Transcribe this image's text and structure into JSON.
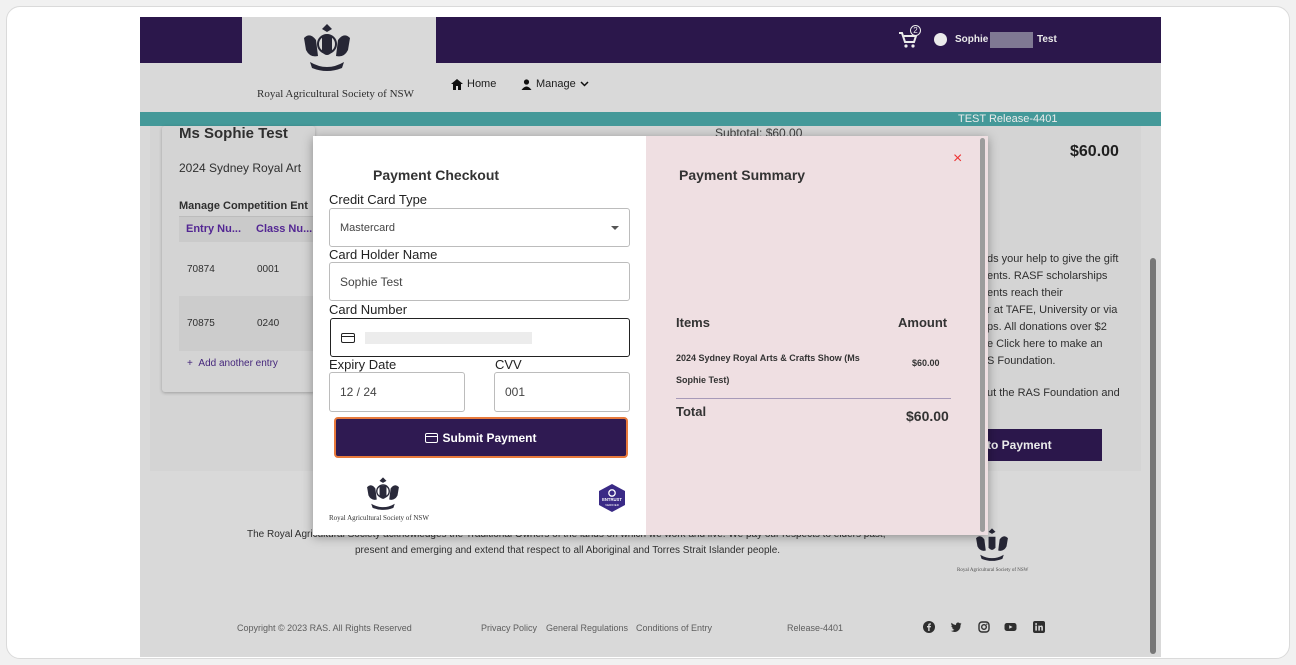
{
  "header": {
    "society_name": "Royal Agricultural Society of NSW",
    "nav": {
      "home": "Home",
      "manage": "Manage"
    },
    "cart_count": "2",
    "user_first": "Sophie",
    "user_last": "Test",
    "release": "TEST Release-4401"
  },
  "page": {
    "customer_name": "Ms Sophie Test",
    "show_name": "2024 Sydney Royal Art",
    "manage_title": "Manage Competition Ent",
    "table_headers": [
      "Entry Nu...",
      "Class Nu..."
    ],
    "rows": [
      {
        "entry": "70874",
        "class": "0001"
      },
      {
        "entry": "70875",
        "class": "0240"
      }
    ],
    "add_entry": "Add another entry",
    "subtotal": "Subtotal: $60.00",
    "right_amount": "$60.00",
    "donation_text": [
      "ds your help to give the gift",
      "ents. RASF scholarships",
      "ents reach their",
      "r at TAFE, University or via",
      "ps. All donations over $2",
      "e Click here to make an",
      "S Foundation.",
      "ut the RAS Foundation and"
    ],
    "to_payment": "to Payment"
  },
  "footer": {
    "ack_line1": "The Royal Agricultural Society acknowledges the Traditional Owners of the lands on which we work and live. We pay our respects to elders past,",
    "ack_line2": "present and emerging and extend that respect to all Aboriginal and Torres Strait Islander people.",
    "crest_text": "Royal Agricultural Society of NSW",
    "copyright": "Copyright © 2023 RAS. All Rights Reserved",
    "links": [
      "Privacy Policy",
      "General Regulations",
      "Conditions of Entry"
    ],
    "release": "Release-4401",
    "social": [
      "facebook-icon",
      "twitter-icon",
      "instagram-icon",
      "youtube-icon",
      "linkedin-icon"
    ]
  },
  "modal": {
    "checkout_title": "Payment Checkout",
    "card_type_label": "Credit Card Type",
    "card_type_value": "Mastercard",
    "holder_label": "Card Holder Name",
    "holder_value": "Sophie Test",
    "number_label": "Card Number",
    "expiry_label": "Expiry Date",
    "expiry_value": "12 / 24",
    "cvv_label": "CVV",
    "cvv_value": "001",
    "submit_label": "Submit Payment",
    "crest_text": "Royal Agricultural Society of NSW",
    "entrust_text": "ENTRUST",
    "entrust_sub": "VERIFIED",
    "close": "×"
  },
  "summary": {
    "title": "Payment Summary",
    "items_header": "Items",
    "amount_header": "Amount",
    "item_desc": "2024 Sydney Royal Arts & Crafts Show (Ms Sophie Test)",
    "item_amount": "$60.00",
    "total_label": "Total",
    "total_value": "$60.00"
  },
  "colors": {
    "brand_purple": "#2f1a52",
    "teal": "#4aa6a6",
    "summary_bg": "#efdfe2",
    "submit_border": "#e87a3c",
    "close_red": "#ee3333"
  }
}
